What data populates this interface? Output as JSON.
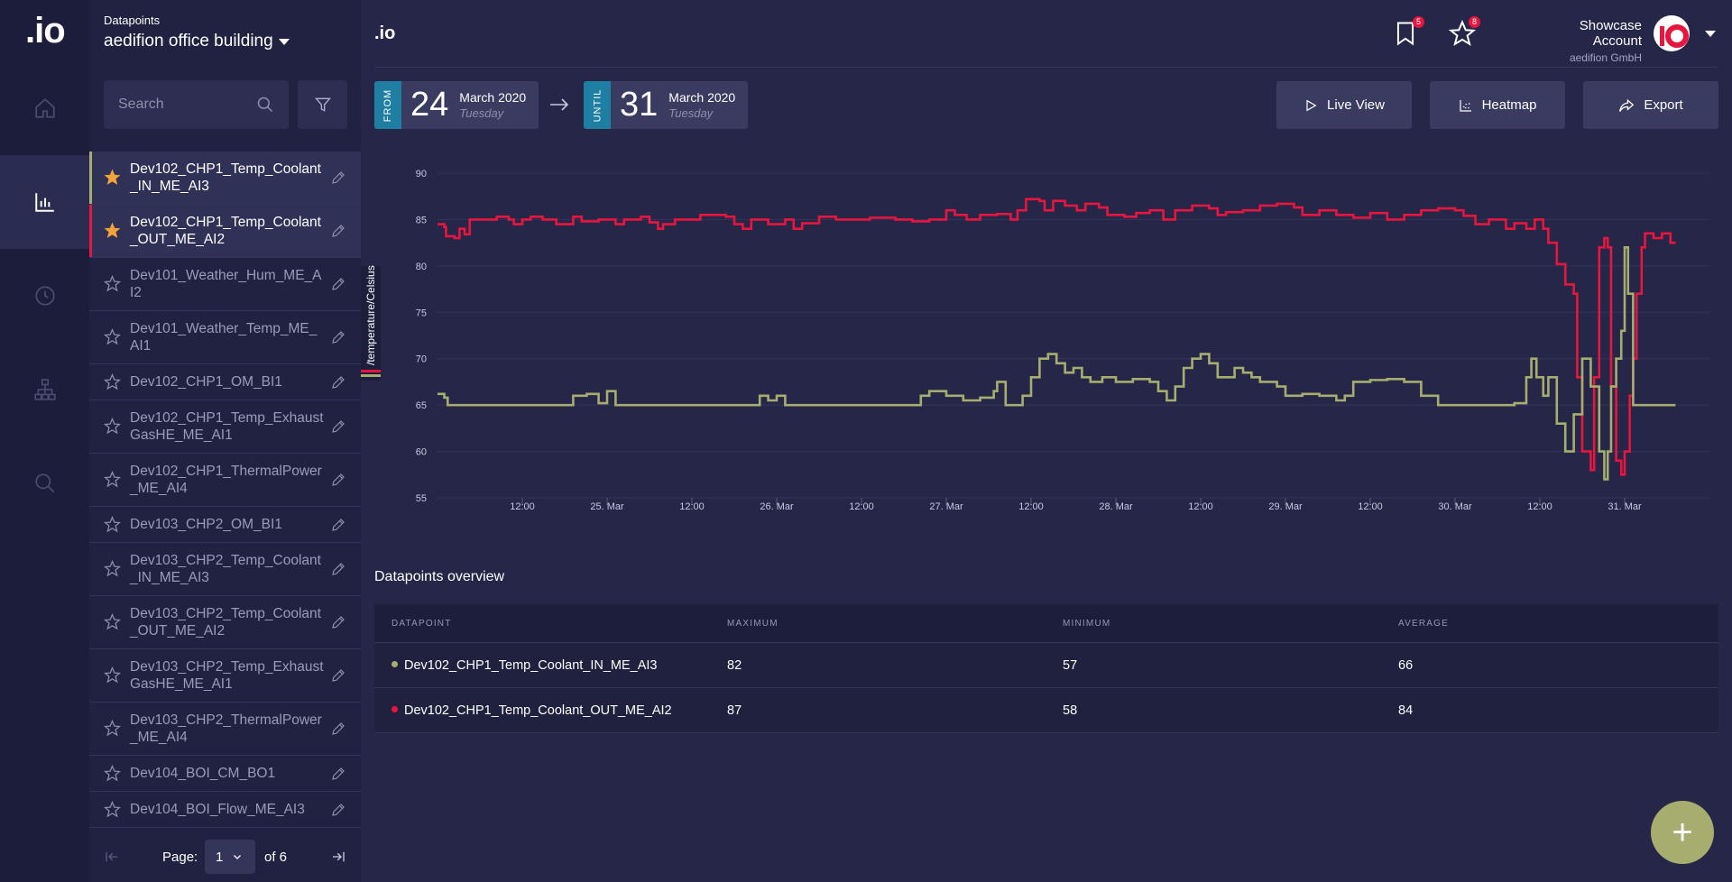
{
  "app": {
    "logo": ".io",
    "brand": ".io"
  },
  "rail": {
    "items": [
      "home-icon",
      "chart-icon",
      "clock-icon",
      "hierarchy-icon",
      "search-icon"
    ],
    "active": "chart-icon"
  },
  "sidebar": {
    "title": "Datapoints",
    "building": "aedifion office building",
    "search_placeholder": "Search",
    "items": [
      {
        "label": "Dev102_CHP1_Temp_Coolant_IN_ME_AI3",
        "starred": true,
        "selected": true,
        "color": "#a6ad6e"
      },
      {
        "label": "Dev102_CHP1_Temp_Coolant_OUT_ME_AI2",
        "starred": true,
        "selected": true,
        "color": "#e8163e"
      },
      {
        "label": "Dev101_Weather_Hum_ME_AI2",
        "starred": false,
        "selected": false
      },
      {
        "label": "Dev101_Weather_Temp_ME_AI1",
        "starred": false,
        "selected": false
      },
      {
        "label": "Dev102_CHP1_OM_BI1",
        "starred": false,
        "selected": false
      },
      {
        "label": "Dev102_CHP1_Temp_ExhaustGasHE_ME_AI1",
        "starred": false,
        "selected": false
      },
      {
        "label": "Dev102_CHP1_ThermalPower_ME_AI4",
        "starred": false,
        "selected": false
      },
      {
        "label": "Dev103_CHP2_OM_BI1",
        "starred": false,
        "selected": false
      },
      {
        "label": "Dev103_CHP2_Temp_Coolant_IN_ME_AI3",
        "starred": false,
        "selected": false
      },
      {
        "label": "Dev103_CHP2_Temp_Coolant_OUT_ME_AI2",
        "starred": false,
        "selected": false
      },
      {
        "label": "Dev103_CHP2_Temp_ExhaustGasHE_ME_AI1",
        "starred": false,
        "selected": false
      },
      {
        "label": "Dev103_CHP2_ThermalPower_ME_AI4",
        "starred": false,
        "selected": false
      },
      {
        "label": "Dev104_BOI_CM_BO1",
        "starred": false,
        "selected": false
      },
      {
        "label": "Dev104_BOI_Flow_ME_AI3",
        "starred": false,
        "selected": false
      }
    ],
    "pager": {
      "label": "Page:",
      "current": "1",
      "of": "of 6"
    }
  },
  "header": {
    "bookmarks_count": "5",
    "favorites_count": "8",
    "account_name": "Showcase Account",
    "account_company": "aedifion GmbH"
  },
  "range": {
    "from": {
      "tag": "FROM",
      "day": "24",
      "month": "March 2020",
      "weekday": "Tuesday"
    },
    "until": {
      "tag": "UNTIL",
      "day": "31",
      "month": "March 2020",
      "weekday": "Tuesday"
    }
  },
  "actions": {
    "live_view": "Live View",
    "heatmap": "Heatmap",
    "export": "Export"
  },
  "chart_data": {
    "type": "line",
    "ylabel": "/temperature/Celsius",
    "ylim": [
      55,
      90
    ],
    "yticks": [
      90,
      85,
      80,
      75,
      70,
      65,
      60,
      55
    ],
    "xlim": [
      "2020-03-24 00:00",
      "2020-03-31 12:00"
    ],
    "xticks": [
      {
        "t": 0.5,
        "label": "12:00"
      },
      {
        "t": 1,
        "label": "25. Mar"
      },
      {
        "t": 1.5,
        "label": "12:00"
      },
      {
        "t": 2,
        "label": "26. Mar"
      },
      {
        "t": 2.5,
        "label": "12:00"
      },
      {
        "t": 3,
        "label": "27. Mar"
      },
      {
        "t": 3.5,
        "label": "12:00"
      },
      {
        "t": 4,
        "label": "28. Mar"
      },
      {
        "t": 4.5,
        "label": "12:00"
      },
      {
        "t": 5,
        "label": "29. Mar"
      },
      {
        "t": 5.5,
        "label": "12:00"
      },
      {
        "t": 6,
        "label": "30. Mar"
      },
      {
        "t": 6.5,
        "label": "12:00"
      },
      {
        "t": 7,
        "label": "31. Mar"
      }
    ],
    "grid": true,
    "series": [
      {
        "name": "Dev102_CHP1_Temp_Coolant_OUT_ME_AI2",
        "color": "#e8163e",
        "points": [
          [
            0,
            84.5
          ],
          [
            0.04,
            84.2
          ],
          [
            0.05,
            83.2
          ],
          [
            0.1,
            83
          ],
          [
            0.13,
            84
          ],
          [
            0.16,
            83.4
          ],
          [
            0.19,
            85
          ],
          [
            0.35,
            85.3
          ],
          [
            0.42,
            85
          ],
          [
            0.45,
            84.5
          ],
          [
            0.5,
            85
          ],
          [
            0.55,
            85.3
          ],
          [
            0.62,
            85
          ],
          [
            0.7,
            84.5
          ],
          [
            0.8,
            85.3
          ],
          [
            0.85,
            84.8
          ],
          [
            0.95,
            85
          ],
          [
            1.05,
            84.5
          ],
          [
            1.1,
            85
          ],
          [
            1.2,
            85.3
          ],
          [
            1.25,
            84.7
          ],
          [
            1.3,
            84
          ],
          [
            1.33,
            84.5
          ],
          [
            1.4,
            85
          ],
          [
            1.55,
            85.5
          ],
          [
            1.7,
            85.3
          ],
          [
            1.75,
            84.5
          ],
          [
            1.8,
            84
          ],
          [
            1.85,
            85
          ],
          [
            1.95,
            84.5
          ],
          [
            2.05,
            85
          ],
          [
            2.1,
            84
          ],
          [
            2.15,
            84.6
          ],
          [
            2.25,
            85.3
          ],
          [
            2.35,
            85
          ],
          [
            2.55,
            85.2
          ],
          [
            2.7,
            85
          ],
          [
            2.8,
            84.8
          ],
          [
            2.9,
            85
          ],
          [
            3.0,
            86
          ],
          [
            3.05,
            85.5
          ],
          [
            3.12,
            85
          ],
          [
            3.2,
            85.5
          ],
          [
            3.3,
            85.6
          ],
          [
            3.38,
            85
          ],
          [
            3.42,
            86
          ],
          [
            3.47,
            87.2
          ],
          [
            3.55,
            87
          ],
          [
            3.58,
            86
          ],
          [
            3.63,
            87
          ],
          [
            3.7,
            86.5
          ],
          [
            3.77,
            86
          ],
          [
            3.82,
            86.7
          ],
          [
            3.9,
            86.3
          ],
          [
            3.95,
            85.5
          ],
          [
            4.05,
            85.3
          ],
          [
            4.12,
            85.7
          ],
          [
            4.2,
            86
          ],
          [
            4.28,
            85
          ],
          [
            4.35,
            86
          ],
          [
            4.45,
            86.5
          ],
          [
            4.55,
            86.2
          ],
          [
            4.6,
            85.5
          ],
          [
            4.65,
            85.8
          ],
          [
            4.75,
            86
          ],
          [
            4.85,
            86.5
          ],
          [
            4.95,
            86.7
          ],
          [
            5.05,
            86.3
          ],
          [
            5.1,
            85.5
          ],
          [
            5.2,
            86
          ],
          [
            5.3,
            85.5
          ],
          [
            5.4,
            85.2
          ],
          [
            5.5,
            85.7
          ],
          [
            5.6,
            85
          ],
          [
            5.7,
            85.5
          ],
          [
            5.8,
            86
          ],
          [
            5.9,
            86.2
          ],
          [
            6.0,
            86
          ],
          [
            6.05,
            85.4
          ],
          [
            6.12,
            84.5
          ],
          [
            6.2,
            85
          ],
          [
            6.3,
            84
          ],
          [
            6.35,
            84.6
          ],
          [
            6.42,
            84
          ],
          [
            6.47,
            85
          ],
          [
            6.52,
            84
          ],
          [
            6.55,
            82.5
          ],
          [
            6.6,
            80.2
          ],
          [
            6.65,
            78
          ],
          [
            6.7,
            77
          ],
          [
            6.72,
            68
          ],
          [
            6.75,
            60
          ],
          [
            6.8,
            58
          ],
          [
            6.82,
            68
          ],
          [
            6.85,
            82
          ],
          [
            6.88,
            83
          ],
          [
            6.9,
            82
          ],
          [
            6.92,
            67
          ],
          [
            6.95,
            59
          ],
          [
            6.98,
            57.5
          ],
          [
            7.0,
            60
          ],
          [
            7.03,
            66
          ],
          [
            7.05,
            70
          ],
          [
            7.07,
            77
          ],
          [
            7.1,
            82
          ],
          [
            7.12,
            83.5
          ],
          [
            7.17,
            83
          ],
          [
            7.22,
            83.5
          ],
          [
            7.27,
            82.5
          ],
          [
            7.3,
            82.5
          ]
        ]
      },
      {
        "name": "Dev102_CHP1_Temp_Coolant_IN_ME_AI3",
        "color": "#a6ad6e",
        "points": [
          [
            0,
            66.2
          ],
          [
            0.04,
            65.8
          ],
          [
            0.06,
            65
          ],
          [
            0.4,
            65
          ],
          [
            0.55,
            65
          ],
          [
            0.78,
            65
          ],
          [
            0.8,
            66
          ],
          [
            0.88,
            66.2
          ],
          [
            0.95,
            65.2
          ],
          [
            1.0,
            66.5
          ],
          [
            1.05,
            65
          ],
          [
            1.5,
            65
          ],
          [
            1.85,
            65
          ],
          [
            1.9,
            66
          ],
          [
            1.95,
            65.5
          ],
          [
            2.0,
            66
          ],
          [
            2.05,
            65
          ],
          [
            2.3,
            65
          ],
          [
            2.8,
            65
          ],
          [
            2.85,
            66
          ],
          [
            2.9,
            66.5
          ],
          [
            3.0,
            66
          ],
          [
            3.1,
            65.5
          ],
          [
            3.2,
            65.8
          ],
          [
            3.28,
            66.5
          ],
          [
            3.3,
            67.5
          ],
          [
            3.35,
            65
          ],
          [
            3.45,
            66
          ],
          [
            3.5,
            68
          ],
          [
            3.55,
            70
          ],
          [
            3.6,
            70.5
          ],
          [
            3.65,
            69.5
          ],
          [
            3.7,
            68.5
          ],
          [
            3.75,
            69
          ],
          [
            3.8,
            68
          ],
          [
            3.85,
            67.5
          ],
          [
            3.92,
            68
          ],
          [
            4.0,
            67.5
          ],
          [
            4.1,
            67.8
          ],
          [
            4.2,
            67.5
          ],
          [
            4.25,
            66.5
          ],
          [
            4.3,
            65.5
          ],
          [
            4.35,
            67
          ],
          [
            4.4,
            69
          ],
          [
            4.45,
            70
          ],
          [
            4.5,
            70.5
          ],
          [
            4.55,
            69.5
          ],
          [
            4.6,
            68
          ],
          [
            4.7,
            69
          ],
          [
            4.75,
            68.5
          ],
          [
            4.8,
            68
          ],
          [
            4.85,
            67.5
          ],
          [
            4.95,
            67
          ],
          [
            5.0,
            66
          ],
          [
            5.1,
            66.2
          ],
          [
            5.2,
            66
          ],
          [
            5.3,
            65.5
          ],
          [
            5.35,
            66
          ],
          [
            5.4,
            67.5
          ],
          [
            5.5,
            67.7
          ],
          [
            5.6,
            67.8
          ],
          [
            5.7,
            67.5
          ],
          [
            5.8,
            66
          ],
          [
            5.9,
            65
          ],
          [
            6.1,
            65
          ],
          [
            6.3,
            65
          ],
          [
            6.35,
            65.2
          ],
          [
            6.42,
            68
          ],
          [
            6.45,
            70
          ],
          [
            6.48,
            68
          ],
          [
            6.52,
            66
          ],
          [
            6.55,
            68
          ],
          [
            6.6,
            63
          ],
          [
            6.65,
            60
          ],
          [
            6.7,
            64
          ],
          [
            6.75,
            70
          ],
          [
            6.8,
            67
          ],
          [
            6.85,
            60
          ],
          [
            6.88,
            57
          ],
          [
            6.9,
            60
          ],
          [
            6.92,
            67
          ],
          [
            6.95,
            70
          ],
          [
            6.98,
            73
          ],
          [
            7.0,
            82
          ],
          [
            7.02,
            77
          ],
          [
            7.05,
            65
          ],
          [
            7.15,
            65
          ],
          [
            7.3,
            65
          ]
        ]
      }
    ]
  },
  "overview": {
    "title": "Datapoints overview",
    "headers": [
      "DATAPOINT",
      "MAXIMUM",
      "MINIMUM",
      "AVERAGE"
    ],
    "rows": [
      {
        "name": "Dev102_CHP1_Temp_Coolant_IN_ME_AI3",
        "max": "82",
        "min": "57",
        "avg": "66",
        "color": "#a6ad6e"
      },
      {
        "name": "Dev102_CHP1_Temp_Coolant_OUT_ME_AI2",
        "max": "87",
        "min": "58",
        "avg": "84",
        "color": "#e8163e"
      }
    ]
  },
  "fab": {
    "label": "+"
  }
}
